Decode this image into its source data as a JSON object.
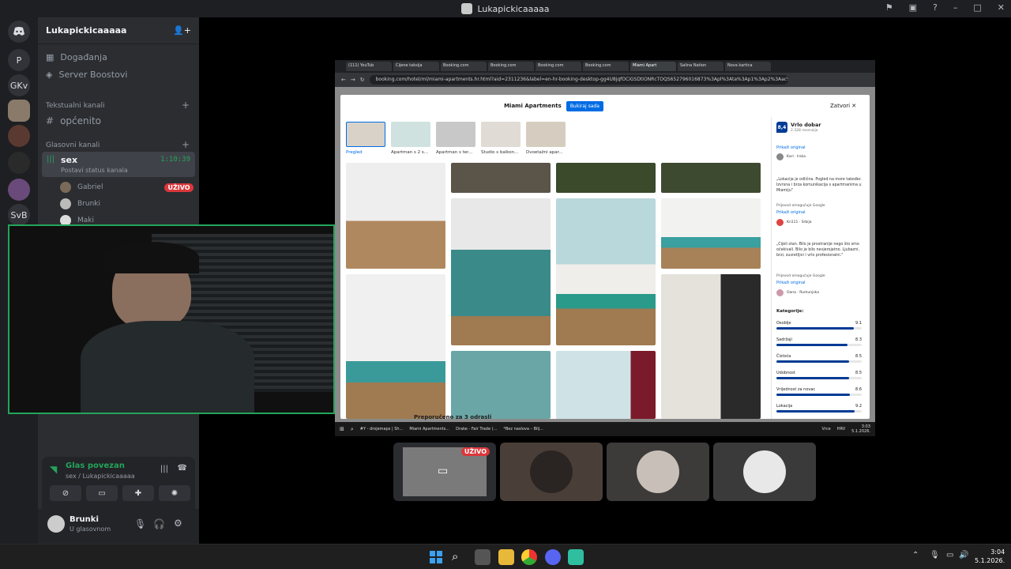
{
  "window": {
    "title": "Lukapickicaaaaa"
  },
  "guilds": [
    "P",
    "GKv",
    "SvB"
  ],
  "server": {
    "name": "Lukapickicaaaaa",
    "menu": [
      {
        "label": "Događanja"
      },
      {
        "label": "Server Boostovi"
      }
    ],
    "text_category": "Tekstualni kanali",
    "text_channels": [
      "općenito"
    ],
    "voice_category": "Glasovni kanali",
    "voice_channel": {
      "name": "sex",
      "timer": "1:10:39",
      "status": "Postavi status kanala"
    },
    "voice_users": [
      {
        "name": "Gabriel",
        "badge": "UŽIVO"
      },
      {
        "name": "Brunki"
      },
      {
        "name": "Maki"
      }
    ]
  },
  "voice_panel": {
    "status": "Glas povezan",
    "path": "sex / Lukapickicaaaaa"
  },
  "user_panel": {
    "name": "Brunki",
    "status": "U glasovnom"
  },
  "browser": {
    "tabs": [
      "(111) YouTub",
      "Cijene taksija",
      "Booking.com",
      "Booking.com",
      "Booking.com",
      "Booking.com",
      "Miami Apart",
      "Salina Nation",
      "Nova kartica"
    ],
    "url": "booking.com/hotel/ml/miami-apartments.hr.html?aid=2311236&label=en-hr-booking-desktop-gg4U8jqfOCiGSDtiONRcTOQS652796016873%3Apl%3Ata%3Ap1%3Ap2%3Aac%3Aap%3Ane"
  },
  "booking": {
    "title": "Miami Apartments",
    "book_btn": "Bukiraj sada",
    "close": "Zatvori",
    "thumbs": [
      "Pregled",
      "Apartman s 2 s...",
      "Apartman s ter...",
      "Studio s balkon...",
      "Dvoetažni apar..."
    ],
    "score": "8,4",
    "score_label": "Vrlo dobar",
    "score_count": "2.328 recenzija",
    "show_original": "Prikaži original",
    "reviewer1": "Kari",
    "reviewer1_country": "Irska",
    "review2": "„Lokacija je odlična. Pogled na more također. Izvrsna i brza komunikacija s apartmanima u Miamiju\"",
    "translated_by": "Prijevod omogućuje Google",
    "reviewer2": "Kn111",
    "reviewer2_country": "Srbija",
    "review3": "„Cijeli stan. Bilo je prostranije nego što smo očekivali. Bilo je bilo nevjerojatno. Ljubazni, brzi, susretljivi i vrlo profesionalni.\"",
    "reviewer3": "Oana",
    "reviewer3_country": "Rumunjska",
    "categories_title": "Kategorije:",
    "categories": [
      {
        "name": "Osoblje",
        "score": "9.1",
        "value": 0.91
      },
      {
        "name": "Sadržaji",
        "score": "8.3",
        "value": 0.83
      },
      {
        "name": "Čistoća",
        "score": "8.5",
        "value": 0.85
      },
      {
        "name": "Udobnost",
        "score": "8.5",
        "value": 0.85
      },
      {
        "name": "Vrijednost za novac",
        "score": "8.6",
        "value": 0.86
      },
      {
        "name": "Lokacija",
        "score": "9.2",
        "value": 0.92
      }
    ],
    "footer_text": "Preporučeno za 3 odrasli"
  },
  "stream_taskbar": [
    "#Y - drojemaps | Sh...",
    "Miami Apartments...",
    "Drake - Fair Trade (...",
    "*Bez naslova – Bilj..."
  ],
  "stream_clock": {
    "time": "3:03",
    "date": "5.1.2026.",
    "lang": "HRV",
    "weather": "Vrce"
  },
  "tiles": [
    {
      "badge": "UŽIVO"
    }
  ],
  "taskbar_clock": {
    "time": "3:04",
    "date": "5.1.2026."
  }
}
